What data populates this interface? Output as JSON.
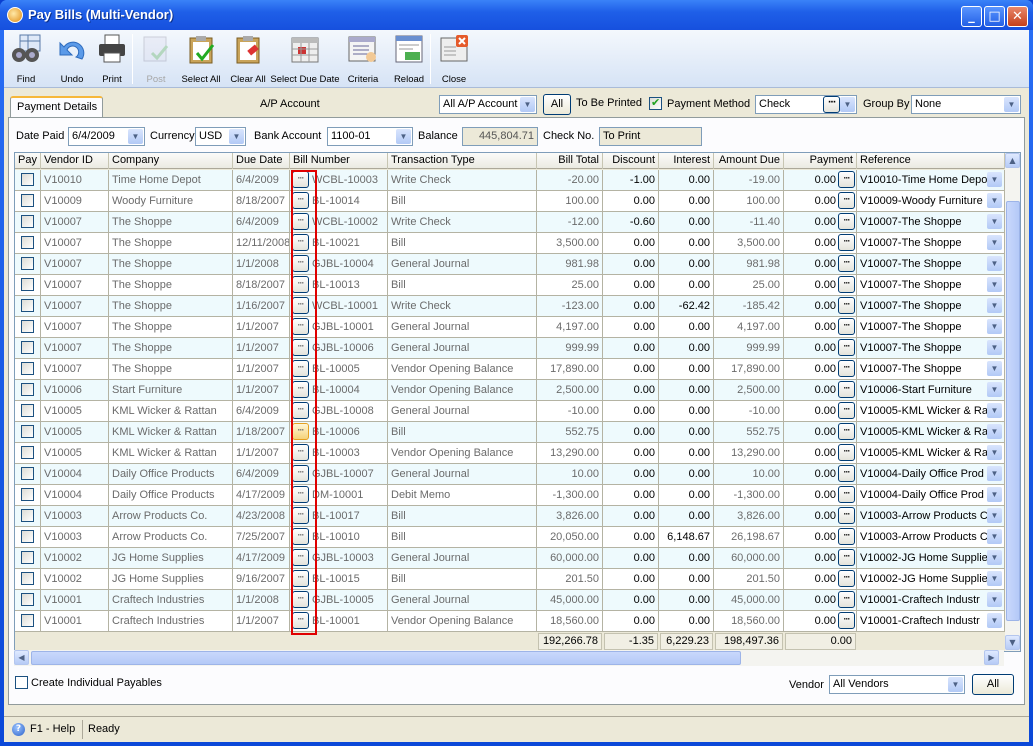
{
  "window": {
    "title": "Pay Bills (Multi-Vendor)"
  },
  "toolbar": [
    {
      "label": "Find",
      "icon": "binoculars-icon",
      "enabled": true
    },
    {
      "label": "Undo",
      "icon": "undo-icon",
      "enabled": true
    },
    {
      "label": "Print",
      "icon": "printer-icon",
      "enabled": true
    },
    {
      "label": "Post",
      "icon": "post-icon",
      "enabled": false
    },
    {
      "label": "Select All",
      "icon": "select-all-icon",
      "enabled": true
    },
    {
      "label": "Clear All",
      "icon": "clear-all-icon",
      "enabled": true
    },
    {
      "label": "Select Due Date",
      "icon": "calendar-icon",
      "enabled": true
    },
    {
      "label": "Criteria",
      "icon": "criteria-icon",
      "enabled": true
    },
    {
      "label": "Reload",
      "icon": "reload-icon",
      "enabled": true
    },
    {
      "label": "Close",
      "icon": "close-window-icon",
      "enabled": true
    }
  ],
  "tab": {
    "label": "Payment Details"
  },
  "filters": {
    "ap_account_label": "A/P Account",
    "ap_account_value": "All A/P Account",
    "all_button": "All",
    "to_be_printed_label": "To Be Printed",
    "to_be_printed_checked": true,
    "payment_method_label": "Payment Method",
    "payment_method_value": "Check",
    "group_by_label": "Group By",
    "group_by_value": "None",
    "date_paid_label": "Date Paid",
    "date_paid_value": "6/4/2009",
    "currency_label": "Currency",
    "currency_value": "USD",
    "bank_account_label": "Bank Account",
    "bank_account_value": "1100-01",
    "balance_label": "Balance",
    "balance_value": "445,804.71",
    "check_no_label": "Check No.",
    "check_no_value": "To Print"
  },
  "grid": {
    "columns": [
      "Pay",
      "Vendor ID",
      "Company",
      "Due Date",
      "Bill Number",
      "Transaction Type",
      "Bill Total",
      "Discount",
      "Interest",
      "Amount Due",
      "Payment",
      "Reference"
    ],
    "rows": [
      {
        "vendor": "V10010",
        "company": "Time Home Depot",
        "due": "6/4/2009",
        "bill": "WCBL-10003",
        "type": "Write Check",
        "total": "-20.00",
        "discount": "-1.00",
        "interest": "0.00",
        "amount_due": "-19.00",
        "payment": "0.00",
        "reference": "V10010-Time Home Depo"
      },
      {
        "vendor": "V10009",
        "company": "Woody Furniture",
        "due": "8/18/2007",
        "bill": "BL-10014",
        "type": "Bill",
        "total": "100.00",
        "discount": "0.00",
        "interest": "0.00",
        "amount_due": "100.00",
        "payment": "0.00",
        "reference": "V10009-Woody Furniture"
      },
      {
        "vendor": "V10007",
        "company": "The Shoppe",
        "due": "6/4/2009",
        "bill": "WCBL-10002",
        "type": "Write Check",
        "total": "-12.00",
        "discount": "-0.60",
        "interest": "0.00",
        "amount_due": "-11.40",
        "payment": "0.00",
        "reference": "V10007-The Shoppe"
      },
      {
        "vendor": "V10007",
        "company": "The Shoppe",
        "due": "12/11/2008",
        "bill": "BL-10021",
        "type": "Bill",
        "total": "3,500.00",
        "discount": "0.00",
        "interest": "0.00",
        "amount_due": "3,500.00",
        "payment": "0.00",
        "reference": "V10007-The Shoppe"
      },
      {
        "vendor": "V10007",
        "company": "The Shoppe",
        "due": "1/1/2008",
        "bill": "GJBL-10004",
        "type": "General Journal",
        "total": "981.98",
        "discount": "0.00",
        "interest": "0.00",
        "amount_due": "981.98",
        "payment": "0.00",
        "reference": "V10007-The Shoppe"
      },
      {
        "vendor": "V10007",
        "company": "The Shoppe",
        "due": "8/18/2007",
        "bill": "BL-10013",
        "type": "Bill",
        "total": "25.00",
        "discount": "0.00",
        "interest": "0.00",
        "amount_due": "25.00",
        "payment": "0.00",
        "reference": "V10007-The Shoppe"
      },
      {
        "vendor": "V10007",
        "company": "The Shoppe",
        "due": "1/16/2007",
        "bill": "WCBL-10001",
        "type": "Write Check",
        "total": "-123.00",
        "discount": "0.00",
        "interest": "-62.42",
        "amount_due": "-185.42",
        "payment": "0.00",
        "reference": "V10007-The Shoppe"
      },
      {
        "vendor": "V10007",
        "company": "The Shoppe",
        "due": "1/1/2007",
        "bill": "GJBL-10001",
        "type": "General Journal",
        "total": "4,197.00",
        "discount": "0.00",
        "interest": "0.00",
        "amount_due": "4,197.00",
        "payment": "0.00",
        "reference": "V10007-The Shoppe"
      },
      {
        "vendor": "V10007",
        "company": "The Shoppe",
        "due": "1/1/2007",
        "bill": "GJBL-10006",
        "type": "General Journal",
        "total": "999.99",
        "discount": "0.00",
        "interest": "0.00",
        "amount_due": "999.99",
        "payment": "0.00",
        "reference": "V10007-The Shoppe"
      },
      {
        "vendor": "V10007",
        "company": "The Shoppe",
        "due": "1/1/2007",
        "bill": "BL-10005",
        "type": "Vendor Opening Balance",
        "total": "17,890.00",
        "discount": "0.00",
        "interest": "0.00",
        "amount_due": "17,890.00",
        "payment": "0.00",
        "reference": "V10007-The Shoppe"
      },
      {
        "vendor": "V10006",
        "company": "Start Furniture",
        "due": "1/1/2007",
        "bill": "BL-10004",
        "type": "Vendor Opening Balance",
        "total": "2,500.00",
        "discount": "0.00",
        "interest": "0.00",
        "amount_due": "2,500.00",
        "payment": "0.00",
        "reference": "V10006-Start Furniture"
      },
      {
        "vendor": "V10005",
        "company": "KML Wicker & Rattan",
        "due": "6/4/2009",
        "bill": "GJBL-10008",
        "type": "General Journal",
        "total": "-10.00",
        "discount": "0.00",
        "interest": "0.00",
        "amount_due": "-10.00",
        "payment": "0.00",
        "reference": "V10005-KML Wicker & Ra"
      },
      {
        "vendor": "V10005",
        "company": "KML Wicker & Rattan",
        "due": "1/18/2007",
        "bill": "BL-10006",
        "type": "Bill",
        "total": "552.75",
        "discount": "0.00",
        "interest": "0.00",
        "amount_due": "552.75",
        "payment": "0.00",
        "reference": "V10005-KML Wicker & Ra"
      },
      {
        "vendor": "V10005",
        "company": "KML Wicker & Rattan",
        "due": "1/1/2007",
        "bill": "BL-10003",
        "type": "Vendor Opening Balance",
        "total": "13,290.00",
        "discount": "0.00",
        "interest": "0.00",
        "amount_due": "13,290.00",
        "payment": "0.00",
        "reference": "V10005-KML Wicker & Ra"
      },
      {
        "vendor": "V10004",
        "company": "Daily Office Products",
        "due": "6/4/2009",
        "bill": "GJBL-10007",
        "type": "General Journal",
        "total": "10.00",
        "discount": "0.00",
        "interest": "0.00",
        "amount_due": "10.00",
        "payment": "0.00",
        "reference": "V10004-Daily Office Prod"
      },
      {
        "vendor": "V10004",
        "company": "Daily Office Products",
        "due": "4/17/2009",
        "bill": "DM-10001",
        "type": "Debit Memo",
        "total": "-1,300.00",
        "discount": "0.00",
        "interest": "0.00",
        "amount_due": "-1,300.00",
        "payment": "0.00",
        "reference": "V10004-Daily Office Prod"
      },
      {
        "vendor": "V10003",
        "company": "Arrow Products Co.",
        "due": "4/23/2008",
        "bill": "BL-10017",
        "type": "Bill",
        "total": "3,826.00",
        "discount": "0.00",
        "interest": "0.00",
        "amount_due": "3,826.00",
        "payment": "0.00",
        "reference": "V10003-Arrow Products C"
      },
      {
        "vendor": "V10003",
        "company": "Arrow Products Co.",
        "due": "7/25/2007",
        "bill": "BL-10010",
        "type": "Bill",
        "total": "20,050.00",
        "discount": "0.00",
        "interest": "6,148.67",
        "amount_due": "26,198.67",
        "payment": "0.00",
        "reference": "V10003-Arrow Products C"
      },
      {
        "vendor": "V10002",
        "company": "JG Home Supplies",
        "due": "4/17/2009",
        "bill": "GJBL-10003",
        "type": "General Journal",
        "total": "60,000.00",
        "discount": "0.00",
        "interest": "0.00",
        "amount_due": "60,000.00",
        "payment": "0.00",
        "reference": "V10002-JG Home Supplie"
      },
      {
        "vendor": "V10002",
        "company": "JG Home Supplies",
        "due": "9/16/2007",
        "bill": "BL-10015",
        "type": "Bill",
        "total": "201.50",
        "discount": "0.00",
        "interest": "0.00",
        "amount_due": "201.50",
        "payment": "0.00",
        "reference": "V10002-JG Home Supplie"
      },
      {
        "vendor": "V10001",
        "company": "Craftech Industries",
        "due": "1/1/2008",
        "bill": "GJBL-10005",
        "type": "General Journal",
        "total": "45,000.00",
        "discount": "0.00",
        "interest": "0.00",
        "amount_due": "45,000.00",
        "payment": "0.00",
        "reference": "V10001-Craftech Industr"
      },
      {
        "vendor": "V10001",
        "company": "Craftech Industries",
        "due": "1/1/2007",
        "bill": "BL-10001",
        "type": "Vendor Opening Balance",
        "total": "18,560.00",
        "discount": "0.00",
        "interest": "0.00",
        "amount_due": "18,560.00",
        "payment": "0.00",
        "reference": "V10001-Craftech Industr"
      }
    ],
    "totals": {
      "total": "192,266.78",
      "discount": "-1.35",
      "interest": "6,229.23",
      "amount_due": "198,497.36",
      "payment": "0.00"
    },
    "highlighted_row_button": 12
  },
  "bottom": {
    "create_individual_label": "Create Individual Payables",
    "create_individual_checked": false,
    "vendor_label": "Vendor",
    "vendor_value": "All Vendors",
    "all_button": "All"
  },
  "status": {
    "help": "F1 - Help",
    "message": "Ready"
  }
}
